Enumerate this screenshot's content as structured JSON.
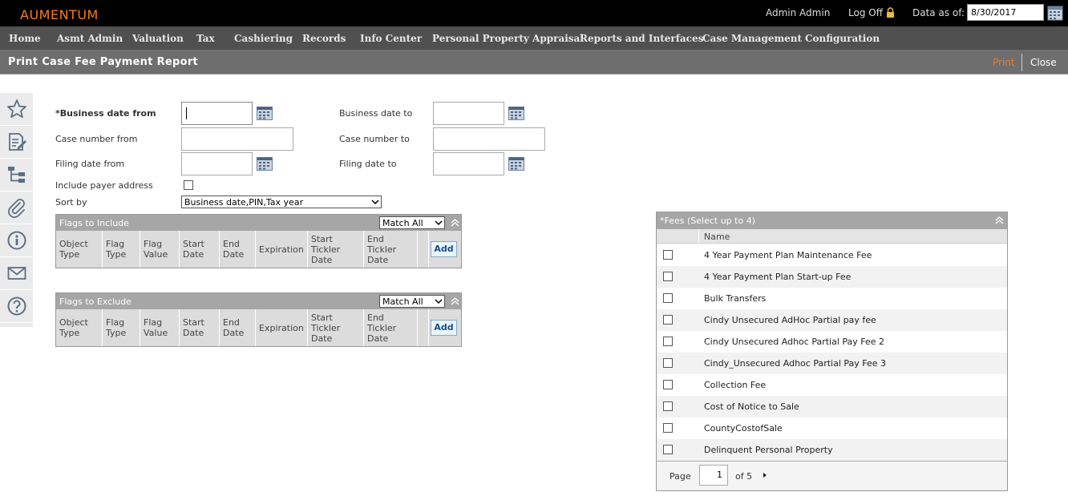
{
  "app": {
    "brand": "AUMENTUM",
    "user": "Admin Admin",
    "logoff": "Log Off",
    "data_as_of_label": "Data as of:",
    "data_as_of_value": "8/30/2017"
  },
  "nav": {
    "items": [
      "Home",
      "Asmt Admin",
      "Valuation",
      "Tax",
      "Cashiering",
      "Records",
      "Info Center",
      "Personal Property Appraisal",
      "Reports and Interfaces",
      "Case Management",
      "Configuration"
    ]
  },
  "titlebar": {
    "title": "Print Case Fee Payment Report",
    "print": "Print",
    "close": "Close"
  },
  "leftrail": {
    "icons": [
      "star-icon",
      "edit-document-icon",
      "hierarchy-icon",
      "paperclip-icon",
      "info-icon",
      "mail-icon",
      "help-icon"
    ]
  },
  "form": {
    "business_date_from": "*Business date from",
    "business_date_to": "Business date to",
    "case_number_from": "Case number from",
    "case_number_to": "Case number to",
    "filing_date_from": "Filing date from",
    "filing_date_to": "Filing date to",
    "include_payer_address": "Include payer address",
    "sort_by_label": "Sort by",
    "sort_by_value": "Business date,PIN,Tax year"
  },
  "flags_include": {
    "title": "Flags to Include",
    "match": "Match All",
    "columns": [
      "Object Type",
      "Flag Type",
      "Flag Value",
      "Start Date",
      "End Date",
      "Expiration",
      "Start Tickler Date",
      "End Tickler Date"
    ],
    "add": "Add"
  },
  "flags_exclude": {
    "title": "Flags to Exclude",
    "match": "Match All",
    "columns": [
      "Object Type",
      "Flag Type",
      "Flag Value",
      "Start Date",
      "End Date",
      "Expiration",
      "Start Tickler Date",
      "End Tickler Date"
    ],
    "add": "Add"
  },
  "fees": {
    "title": "*Fees (Select up to 4)",
    "name_header": "Name",
    "rows": [
      "4 Year Payment Plan Maintenance Fee",
      "4 Year Payment Plan Start-up Fee",
      "Bulk Transfers",
      "Cindy Unsecured AdHoc Partial pay fee",
      "Cindy Unsecured Adhoc Partial Pay Fee 2",
      "Cindy_Unsecured Adhoc Partial Pay Fee 3",
      "Collection Fee",
      "Cost of Notice to Sale",
      "CountyCostofSale",
      "Delinquent Personal Property"
    ],
    "page_label": "Page",
    "page_value": "1",
    "of_label": "of 5"
  },
  "colors": {
    "brand": "#f47b20",
    "topbar": "#000000",
    "nav": "#505050",
    "titlebar": "#6e6e6e",
    "panel_header": "#a6a6a6"
  }
}
